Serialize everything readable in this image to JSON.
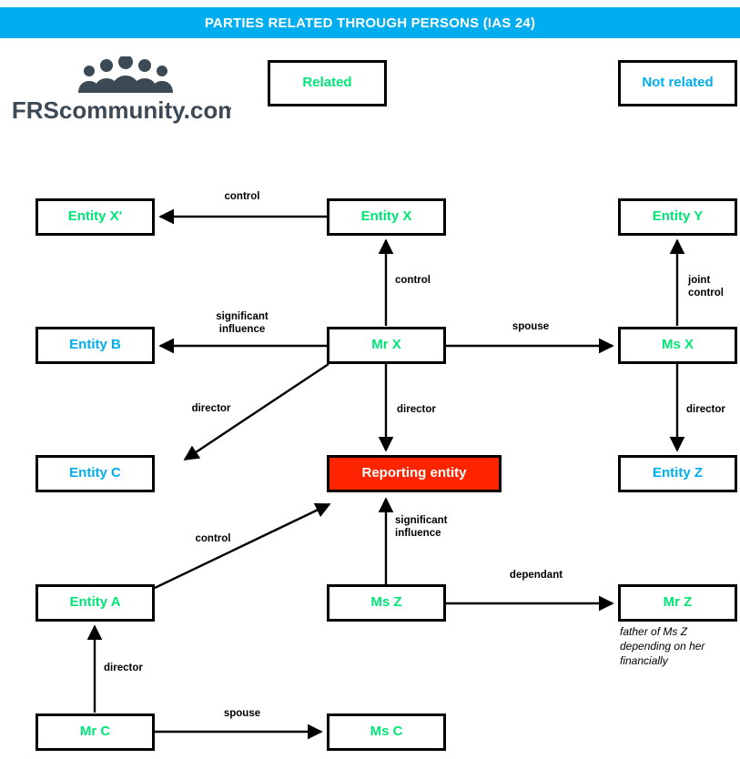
{
  "header": {
    "title": "PARTIES RELATED THROUGH PERSONS (IAS 24)",
    "bar_color": "#00AEEF"
  },
  "logo": {
    "wordmark": "IFRScommunity.com",
    "icon": "group-of-people-icon",
    "color": "#3C4A55"
  },
  "legend": [
    {
      "label": "Related",
      "color": "#00E676",
      "state": "related"
    },
    {
      "label": "Not related",
      "color": "#00AEEF",
      "state": "not-related"
    }
  ],
  "colors": {
    "related_green": "#00E676",
    "not_related_blue": "#00AEEF",
    "reporting_red": "#FF2400",
    "line_black": "#000000",
    "header_cyan": "#00AEEF"
  },
  "nodes": [
    {
      "id": "entity-x-prime",
      "label": "Entity X'",
      "state": "related"
    },
    {
      "id": "entity-x",
      "label": "Entity X",
      "state": "related"
    },
    {
      "id": "entity-y",
      "label": "Entity Y",
      "state": "related"
    },
    {
      "id": "entity-b",
      "label": "Entity B",
      "state": "not-related"
    },
    {
      "id": "mr-x",
      "label": "Mr X",
      "state": "related"
    },
    {
      "id": "ms-x",
      "label": "Ms X",
      "state": "related"
    },
    {
      "id": "entity-c",
      "label": "Entity C",
      "state": "not-related"
    },
    {
      "id": "reporting-entity",
      "label": "Reporting entity",
      "state": "reporting"
    },
    {
      "id": "entity-z",
      "label": "Entity Z",
      "state": "not-related"
    },
    {
      "id": "entity-a",
      "label": "Entity A",
      "state": "related"
    },
    {
      "id": "ms-z",
      "label": "Ms Z",
      "state": "related"
    },
    {
      "id": "mr-z",
      "label": "Mr Z",
      "state": "related"
    },
    {
      "id": "mr-c",
      "label": "Mr C",
      "state": "related"
    },
    {
      "id": "ms-c",
      "label": "Ms C",
      "state": "related"
    }
  ],
  "edges": [
    {
      "id": "entity-x-to-entity-x-prime",
      "label": "control"
    },
    {
      "id": "mr-x-to-entity-x",
      "label": "control"
    },
    {
      "id": "ms-x-to-entity-y",
      "label": "joint\ncontrol"
    },
    {
      "id": "mr-x-to-entity-b",
      "label": "significant\ninfluence"
    },
    {
      "id": "mr-x-to-ms-x",
      "label": "spouse"
    },
    {
      "id": "mr-x-to-entity-c",
      "label": "director"
    },
    {
      "id": "mr-x-to-reporting-entity",
      "label": "director"
    },
    {
      "id": "ms-x-to-entity-z",
      "label": "director"
    },
    {
      "id": "entity-a-to-reporting-entity",
      "label": "control"
    },
    {
      "id": "ms-z-to-reporting-entity",
      "label": "significant\ninfluence"
    },
    {
      "id": "ms-z-to-mr-z",
      "label": "dependant"
    },
    {
      "id": "mr-c-to-entity-a",
      "label": "director"
    },
    {
      "id": "mr-c-to-ms-c",
      "label": "spouse"
    }
  ],
  "annotations": [
    {
      "id": "mr-z-note",
      "text": "father of Ms Z\ndepending on her\nfinancially"
    }
  ]
}
